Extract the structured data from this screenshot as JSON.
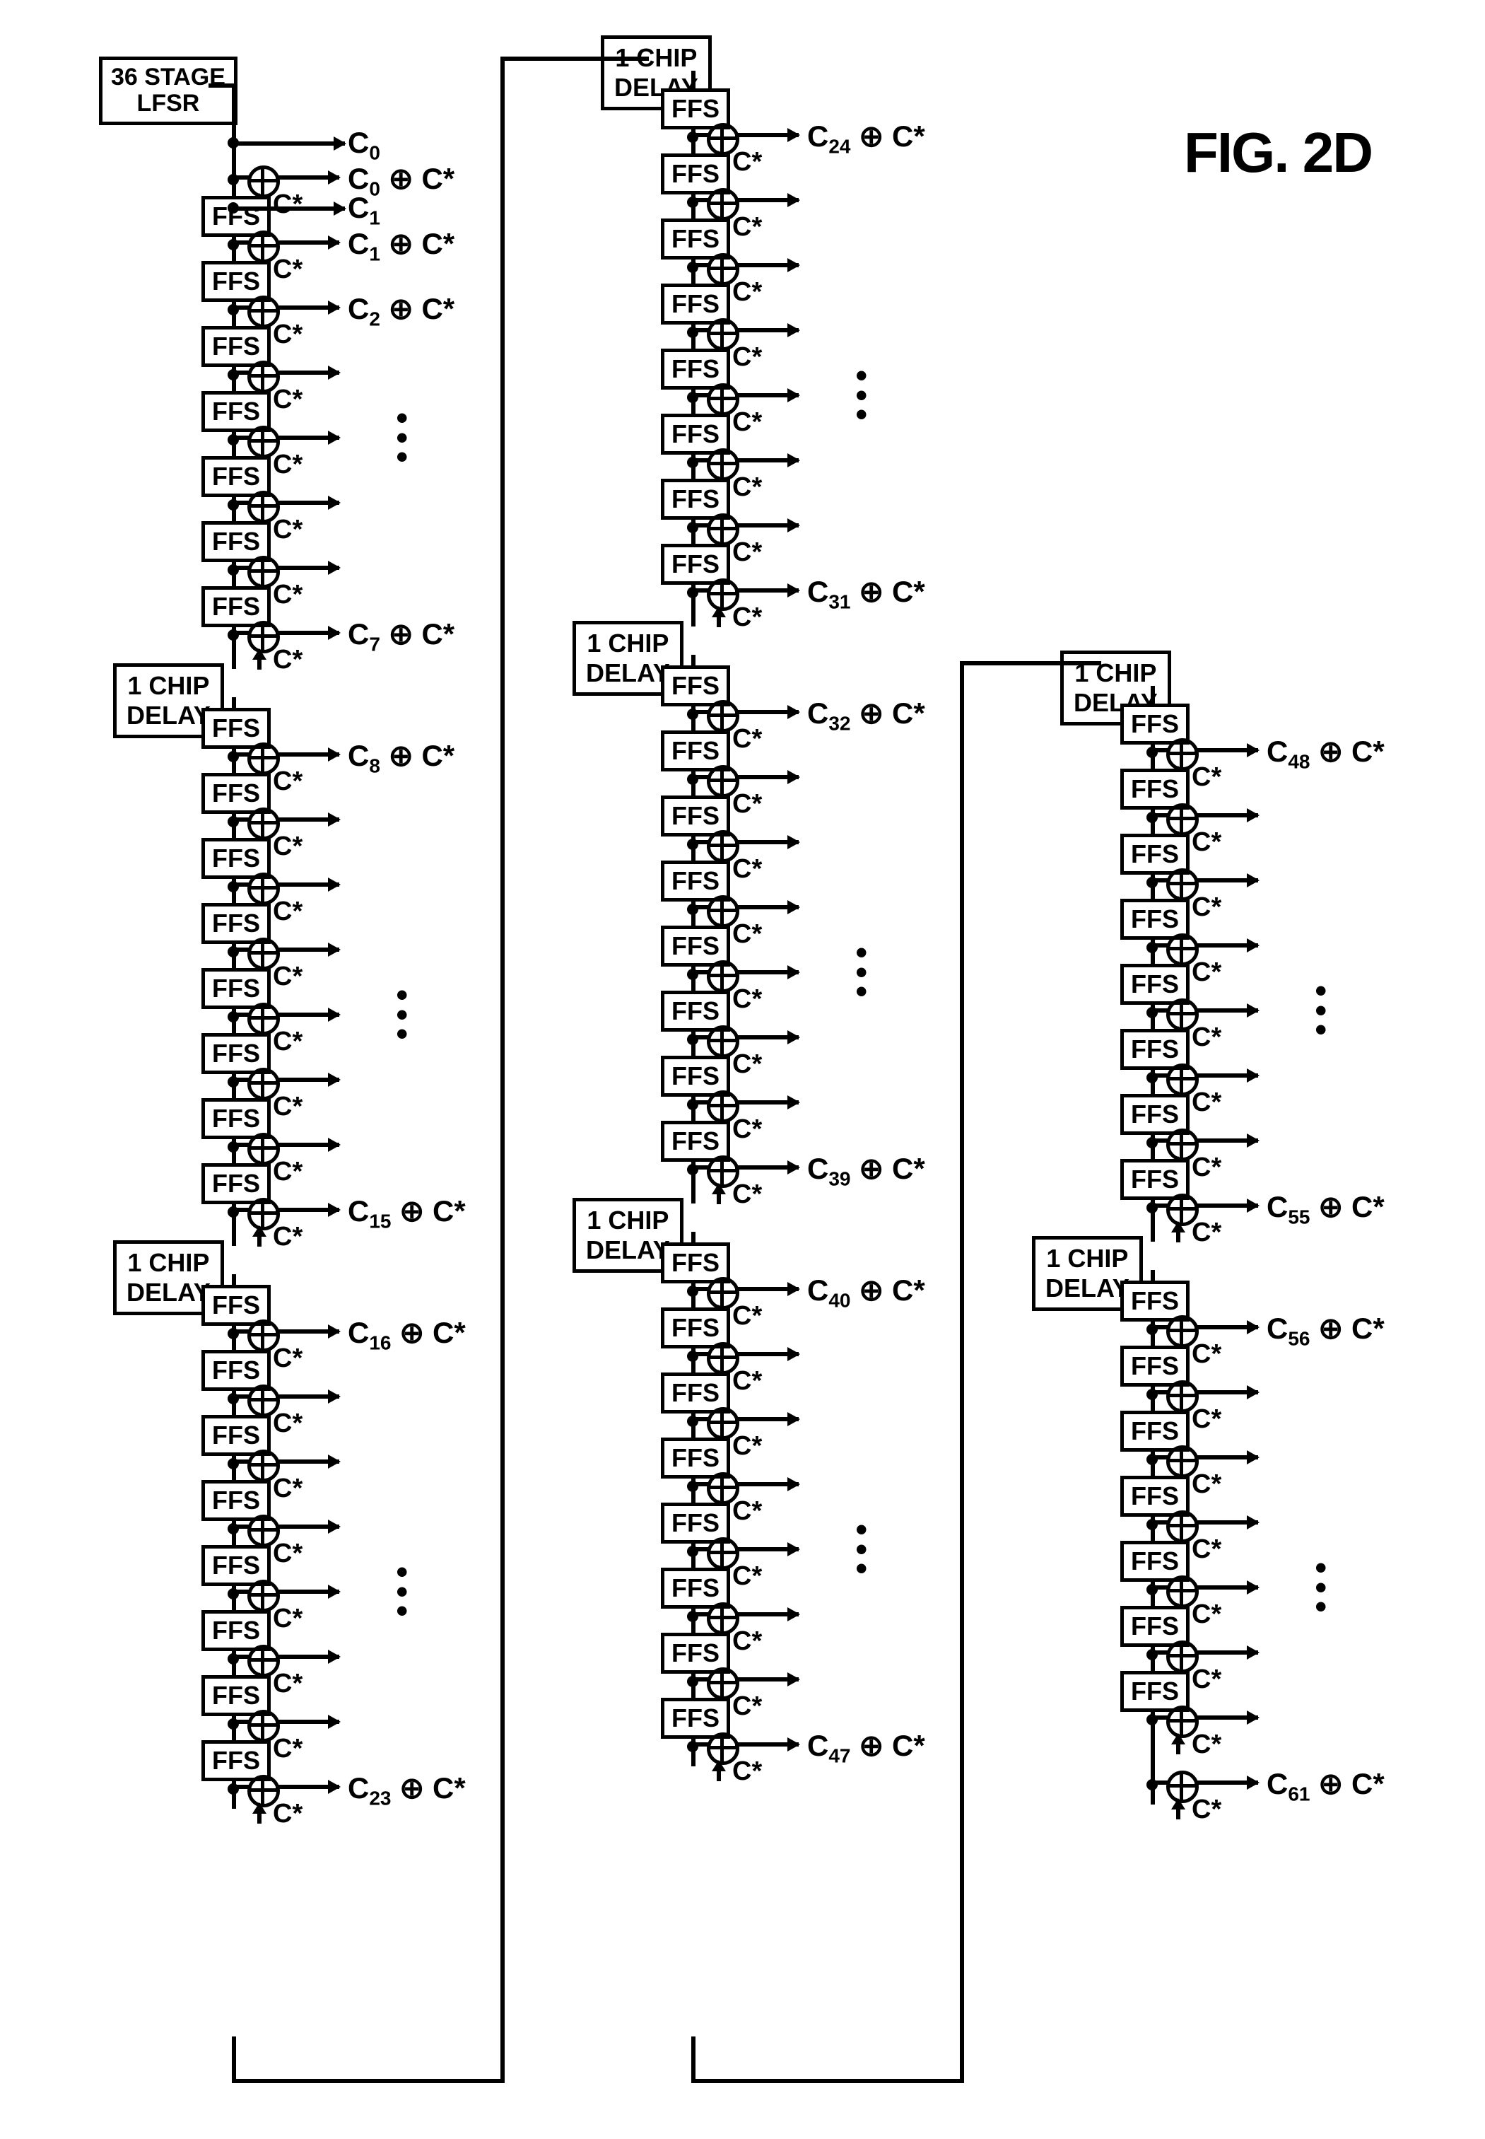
{
  "figure_label": "FIG. 2D",
  "lfsr_label": "36 STAGE\nLFSR",
  "delay_label": "1 CHIP DELAY",
  "ffs_label": "FFS",
  "csub": "C*",
  "xor_sym": "⊕",
  "columns": [
    {
      "top_box": "lfsr",
      "groups": [
        {
          "start": 0,
          "direct_tap_at_0": true
        },
        {
          "start": 8
        },
        {
          "start": 16
        }
      ]
    },
    {
      "top_box": "delay",
      "groups": [
        {
          "start": 24
        },
        {
          "start": 32
        },
        {
          "start": 40
        }
      ]
    },
    {
      "top_box": null,
      "groups": [
        {
          "start": 48,
          "offset_top": true
        },
        {
          "start": 56,
          "short": true
        }
      ]
    }
  ]
}
